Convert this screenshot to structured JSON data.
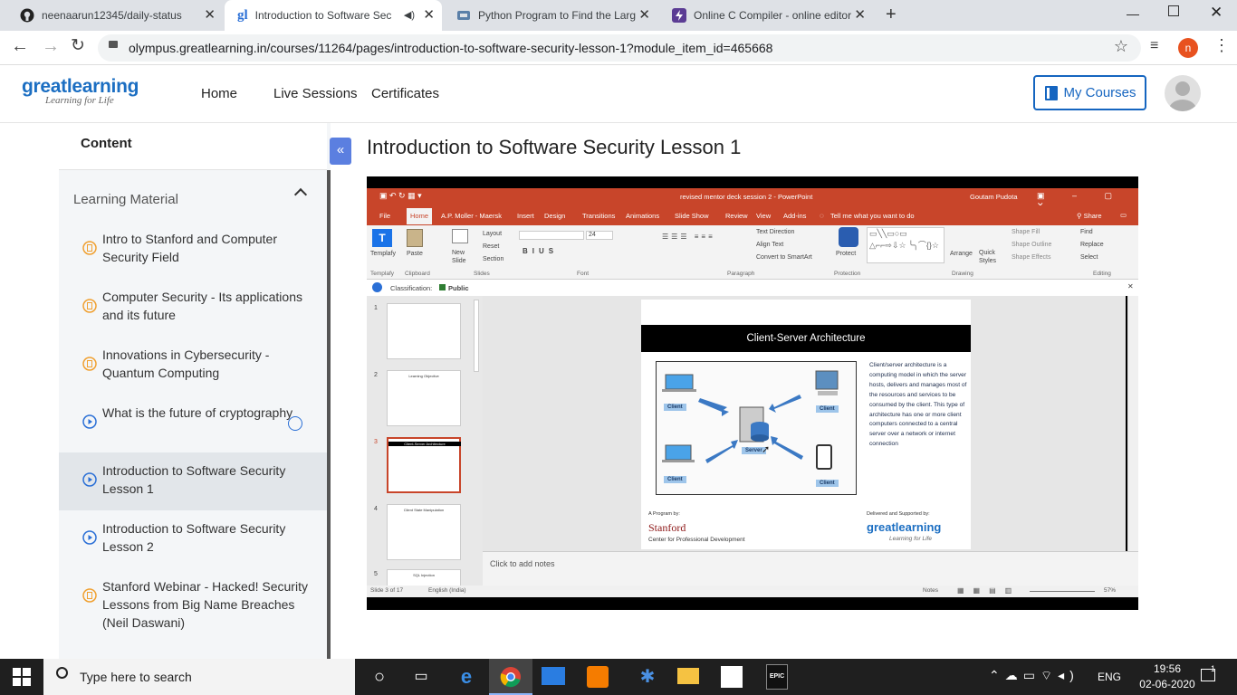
{
  "browser": {
    "tabs": [
      {
        "title": "neenaarun12345/daily-status",
        "icon": "github-icon"
      },
      {
        "title": "Introduction to Software Sec",
        "icon": "greatlearning-gl-icon",
        "active": true
      },
      {
        "title": "Python Program to Find the Larg",
        "icon": "geeks-icon"
      },
      {
        "title": "Online C Compiler - online editor",
        "icon": "bolt-icon"
      }
    ],
    "url": "olympus.greatlearning.in/courses/11264/pages/introduction-to-software-security-lesson-1?module_item_id=465668",
    "profile_initial": "n"
  },
  "header": {
    "logo_text": "greatlearning",
    "logo_sub": "Learning for Life",
    "nav": [
      "Home",
      "Live Sessions",
      "Certificates"
    ],
    "my_courses": "My Courses"
  },
  "sidebar": {
    "title": "Content",
    "section": "Learning Material",
    "items": [
      {
        "label": "Intro to Stanford and Computer Security Field",
        "type": "doc"
      },
      {
        "label": "Computer Security - Its applications and its future",
        "type": "doc"
      },
      {
        "label": "Innovations in Cybersecurity - Quantum Computing",
        "type": "doc"
      },
      {
        "label": "What is the future of cryptography",
        "type": "video"
      },
      {
        "label": "Introduction to Software Security Lesson 1",
        "type": "video",
        "active": true
      },
      {
        "label": "Introduction to Software Security Lesson 2",
        "type": "video"
      },
      {
        "label": "Stanford Webinar - Hacked! Security Lessons from Big Name Breaches (Neil Daswani)",
        "type": "doc"
      }
    ]
  },
  "main": {
    "title": "Introduction to Software Security Lesson 1"
  },
  "powerpoint": {
    "window_title": "revised mentor deck session 2  -  PowerPoint",
    "user": "Goutam Pudota",
    "ribbon_tabs": [
      "File",
      "Home",
      "A.P. Moller - Maersk",
      "Insert",
      "Design",
      "Transitions",
      "Animations",
      "Slide Show",
      "Review",
      "View",
      "Add-ins"
    ],
    "tell_me": "Tell me what you want to do",
    "share": "Share",
    "groups": [
      "Templafy",
      "Clipboard",
      "Slides",
      "Font",
      "Paragraph",
      "Protection",
      "Drawing",
      "Editing"
    ],
    "buttons": {
      "templafy": "Templafy",
      "paste": "Paste",
      "new_slide": "New Slide",
      "layout": "Layout",
      "reset": "Reset",
      "section": "Section",
      "text_direction": "Text Direction",
      "align_text": "Align Text",
      "convert_smartart": "Convert to SmartArt",
      "protect": "Protect",
      "arrange": "Arrange",
      "quick_styles": "Quick Styles",
      "shape_fill": "Shape Fill",
      "shape_outline": "Shape Outline",
      "shape_effects": "Shape Effects",
      "find": "Find",
      "replace": "Replace",
      "select": "Select",
      "font_size": "24"
    },
    "classification_label": "Classification:",
    "classification_value": "Public",
    "thumb_numbers": [
      "1",
      "2",
      "3",
      "4",
      "5"
    ],
    "thumb_titles": [
      "",
      "Learning Objective",
      "Client-Server Architecture",
      "Client State Manipulation",
      "SQL Injection"
    ],
    "slide": {
      "heading": "Client-Server Architecture",
      "client_label": "Client",
      "server_label": "Server",
      "desc": "Client/server architecture is a computing model in which the server hosts, delivers and manages most of the resources and services to be consumed by the client. This type of architecture has one or more client computers connected to a central server over a network or internet connection",
      "program_by": "A Program by:",
      "stanford": "Stanford",
      "stanford_sub": "Center for Professional Development",
      "delivered_by": "Delivered and Supported by:",
      "gl": "greatlearning",
      "gl_sub": "Learning for Life"
    },
    "notes_placeholder": "Click to add notes",
    "status_left": "Slide 3 of 17",
    "status_lang": "English (India)",
    "notes": "Notes",
    "zoom": "57%"
  },
  "taskbar": {
    "search": "Type here to search",
    "lang": "ENG",
    "time": "19:56",
    "date": "02-06-2020",
    "notif_count": "1"
  },
  "colors": {
    "accent": "#1565c0",
    "ppt_orange": "#c8452a",
    "sidebar_icon": "#f0a030",
    "video_icon": "#2a6fd6"
  }
}
